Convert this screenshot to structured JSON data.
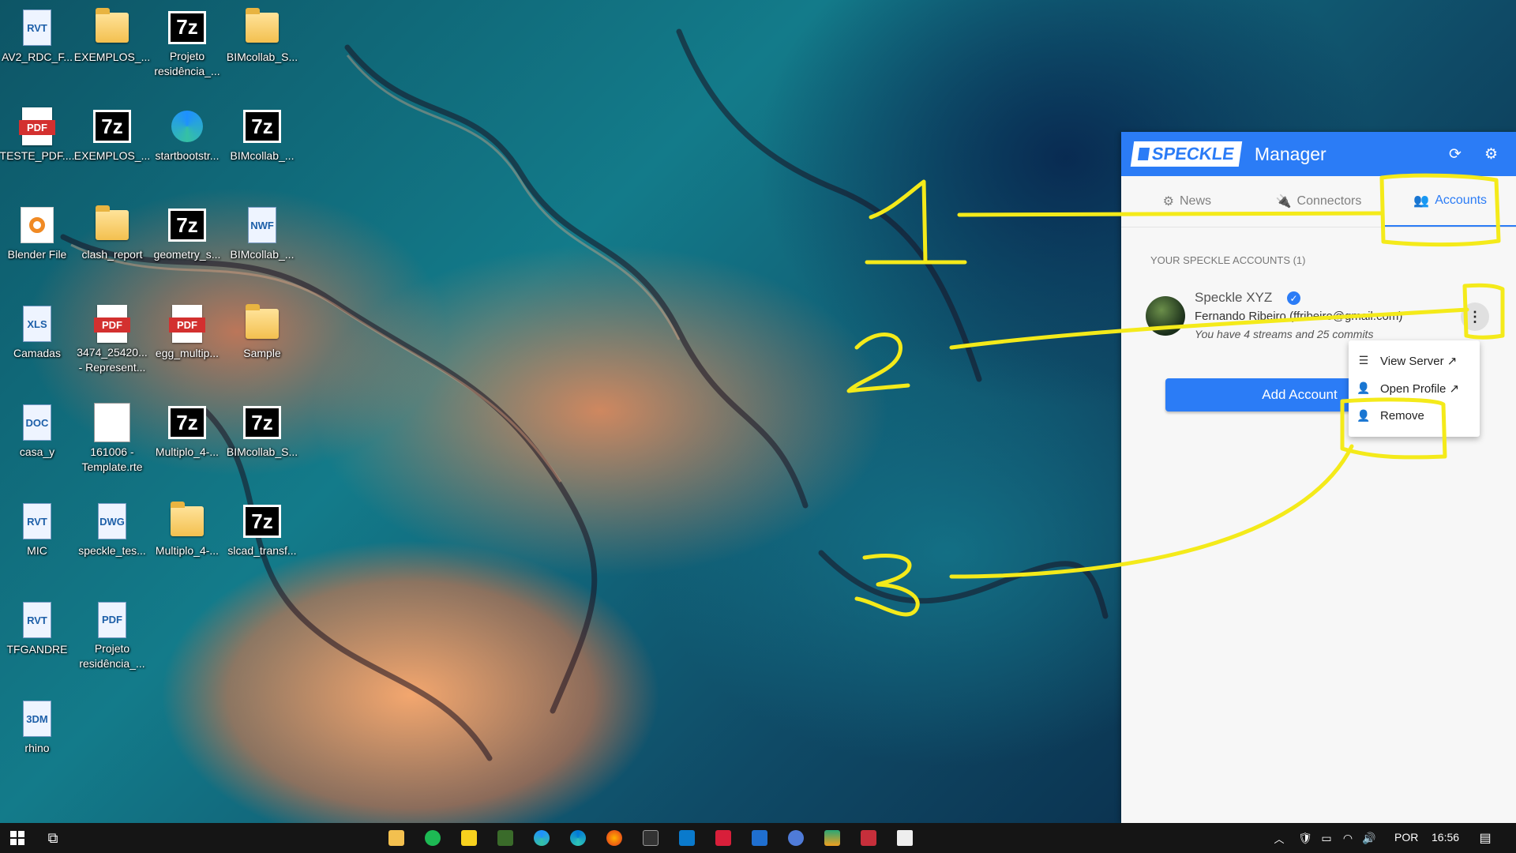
{
  "desktop_icons": [
    {
      "label": "AV2_RDC_F...",
      "kind": "doc",
      "glyph": "RVT"
    },
    {
      "label": "EXEMPLOS_...",
      "kind": "folder"
    },
    {
      "label": "Projeto\nresidência_...",
      "kind": "7z",
      "glyph": "7z"
    },
    {
      "label": "BIMcollab_S...",
      "kind": "folder"
    },
    {
      "label": "TESTE_PDF....",
      "kind": "pdf",
      "glyph": "PDF"
    },
    {
      "label": "EXEMPLOS_...",
      "kind": "7z",
      "glyph": "7z"
    },
    {
      "label": "startbootstr...",
      "kind": "edge"
    },
    {
      "label": "BIMcollab_...",
      "kind": "7z",
      "glyph": "7z"
    },
    {
      "label": "Blender File",
      "kind": "blender"
    },
    {
      "label": "clash_report",
      "kind": "folder"
    },
    {
      "label": "geometry_s...",
      "kind": "7z",
      "glyph": "7z"
    },
    {
      "label": "BIMcollab_...",
      "kind": "doc",
      "glyph": "NWF"
    },
    {
      "label": "Camadas",
      "kind": "doc",
      "glyph": "XLS"
    },
    {
      "label": "3474_25420...\n- Represent...",
      "kind": "pdf",
      "glyph": "PDF"
    },
    {
      "label": "egg_multip...",
      "kind": "pdf",
      "glyph": "PDF"
    },
    {
      "label": "Sample",
      "kind": "folder"
    },
    {
      "label": "casa_y",
      "kind": "doc",
      "glyph": "DOC"
    },
    {
      "label": "161006 -\nTemplate.rte",
      "kind": "file"
    },
    {
      "label": "Multiplo_4-...",
      "kind": "7z",
      "glyph": "7z"
    },
    {
      "label": "BIMcollab_S...",
      "kind": "7z",
      "glyph": "7z"
    },
    {
      "label": "MIC",
      "kind": "doc",
      "glyph": "RVT"
    },
    {
      "label": "speckle_tes...",
      "kind": "doc",
      "glyph": "DWG"
    },
    {
      "label": "Multiplo_4-...",
      "kind": "folder"
    },
    {
      "label": "slcad_transf...",
      "kind": "7z",
      "glyph": "7z"
    },
    {
      "label": "TFGANDRE",
      "kind": "doc",
      "glyph": "RVT"
    },
    {
      "label": "Projeto\nresidência_...",
      "kind": "doc",
      "glyph": "PDF"
    },
    {
      "label": "rhino",
      "kind": "doc",
      "glyph": "3DM"
    }
  ],
  "speckle": {
    "logo_text": "SPECKLE",
    "title": "Manager",
    "tabs": [
      {
        "label": "News",
        "icon": "gear-icon"
      },
      {
        "label": "Connectors",
        "icon": "plug-icon"
      },
      {
        "label": "Accounts",
        "icon": "people-icon"
      }
    ],
    "section_title": "YOUR SPECKLE ACCOUNTS (1)",
    "account": {
      "name": "Speckle XYZ",
      "email": "Fernando Ribeiro (ffribeiro@gmail.com)",
      "stats": "You have 4 streams and 25 commits"
    },
    "add_account_label": "Add Account",
    "menu": [
      {
        "label": "View Server ↗",
        "icon": "server-icon"
      },
      {
        "label": "Open Profile ↗",
        "icon": "profile-icon"
      },
      {
        "label": "Remove",
        "icon": "remove-user-icon"
      }
    ],
    "accent": "#2b7cf6"
  },
  "annotations": {
    "numbers": [
      "1",
      "2",
      "3"
    ],
    "color": "#f4ea1a"
  },
  "taskbar": {
    "language": "POR",
    "clock": "16:56"
  }
}
